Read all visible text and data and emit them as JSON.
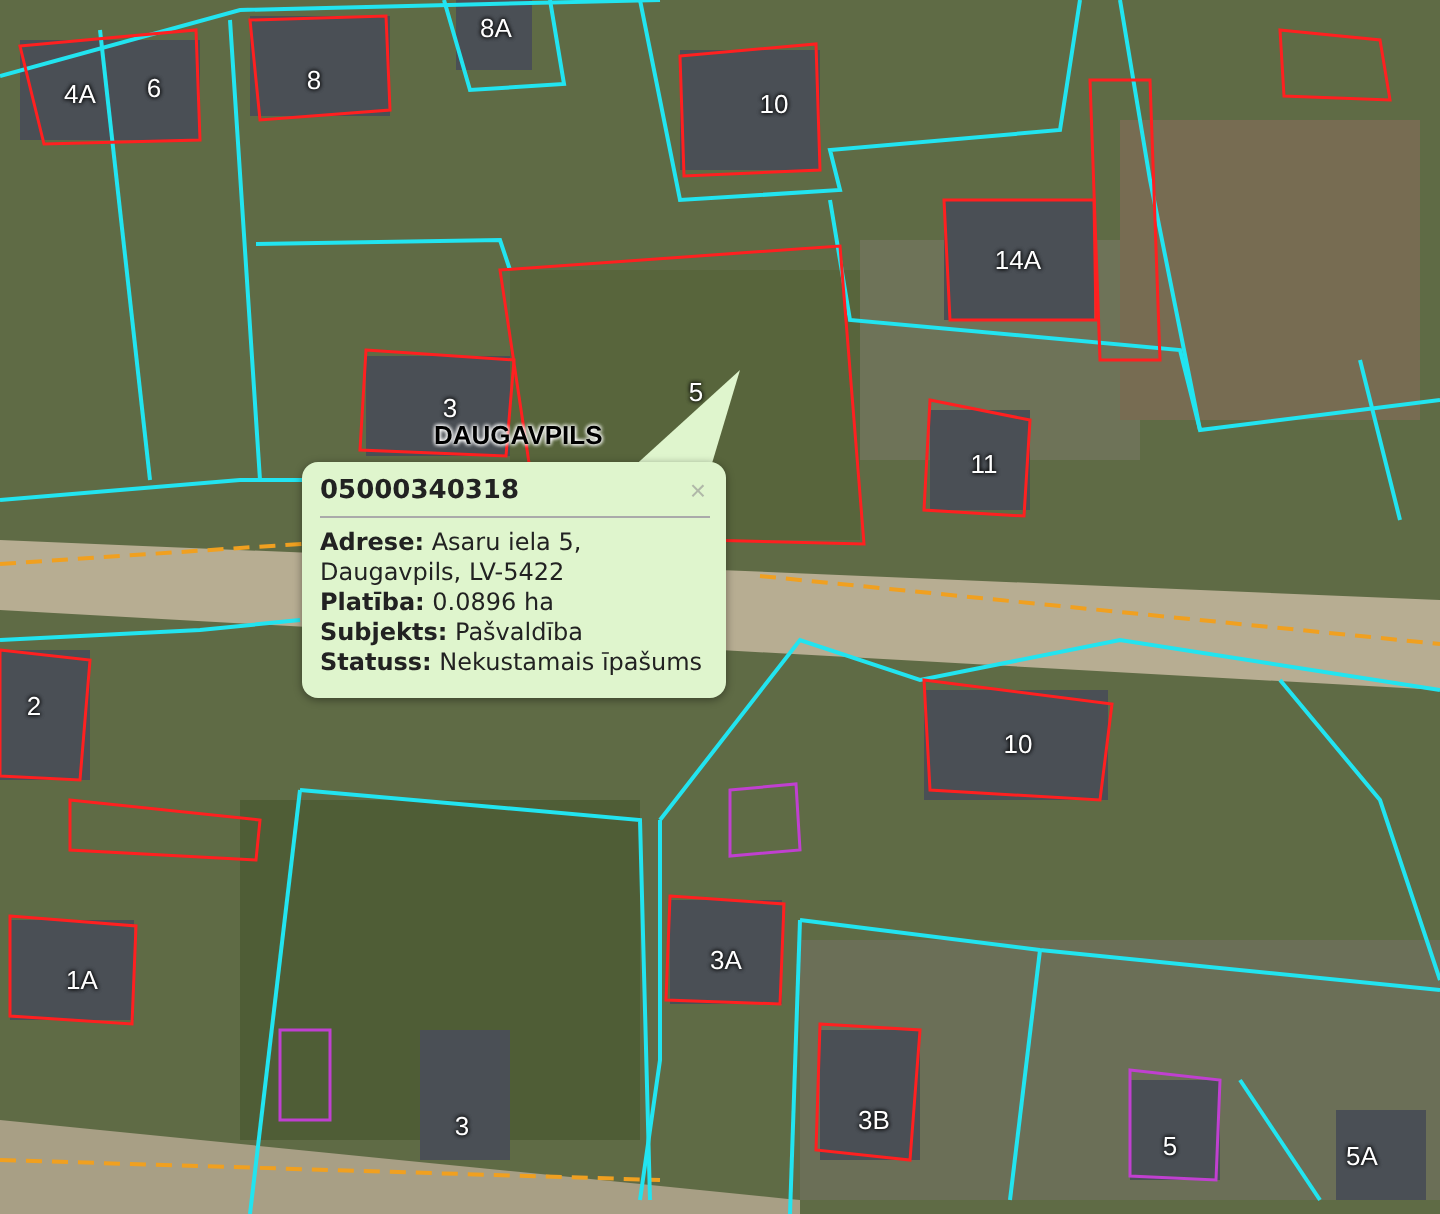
{
  "map": {
    "parcel_labels": [
      "4A",
      "6",
      "8",
      "8A",
      "10",
      "14A",
      "3",
      "5",
      "11",
      "2",
      "10",
      "1A",
      "3A",
      "3",
      "3B",
      "5",
      "5A"
    ],
    "place_label": "DAUGAVPILS"
  },
  "popup": {
    "title": "05000340318",
    "close": "×",
    "fields": [
      "**Adrese:** Asaru iela 5, Daugavpils, LV-5422",
      "**Platība:** 0.0896 ha",
      "**Subjekts:** Pašvaldība",
      "**Statuss:** Nekustamais īpašums"
    ]
  }
}
